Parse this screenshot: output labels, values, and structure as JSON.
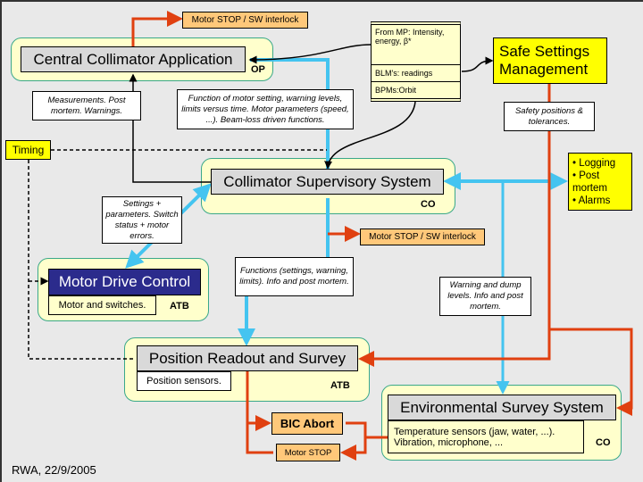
{
  "colors": {
    "red": "#e04010",
    "blue": "#44c4f0",
    "black": "#000000",
    "navy": "#2b2b8c",
    "panel": "#ffffcc",
    "yellow": "#ffff00",
    "orange": "#ffc87a"
  },
  "motor_stop_top": "Motor STOP / SW interlock",
  "central": {
    "title": "Central Collimator Application",
    "tag": "OP"
  },
  "mp": {
    "from": "From MP: Intensity, energy, β*",
    "blm": "BLM's: readings",
    "bpm": "BPMs:Orbit"
  },
  "safe": "Safe Settings Management",
  "notes": {
    "measurements": "Measurements. Post mortem. Warnings.",
    "function": "Function of motor setting, warning levels, limits versus time. Motor parameters (speed, ...). Beam-loss driven functions.",
    "safety": "Safety positions & tolerances.",
    "settings": "Settings + parameters. Switch status + motor errors.",
    "functions": "Functions (settings, warning, limits). Info and post mortem.",
    "warning": "Warning and dump levels. Info and post mortem."
  },
  "timing": "Timing",
  "logging": [
    "• Logging",
    "• Post mortem",
    "• Alarms"
  ],
  "supervisory": {
    "title": "Collimator Supervisory System",
    "tag": "CO"
  },
  "motor_stop_mid": "Motor STOP / SW interlock",
  "mdc": {
    "title": "Motor Drive Control",
    "sub": "Motor and switches.",
    "tag": "ATB"
  },
  "prs": {
    "title": "Position Readout and Survey",
    "sub": "Position sensors.",
    "tag": "ATB"
  },
  "env": {
    "title": "Environmental Survey System",
    "sub": "Temperature sensors (jaw, water, ...). Vibration, microphone, ...",
    "tag": "CO"
  },
  "bic": "BIC Abort",
  "motor_stop_bottom": "Motor STOP",
  "footer": "RWA, 22/9/2005"
}
